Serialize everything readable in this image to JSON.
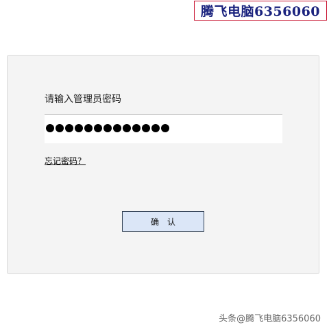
{
  "watermark": {
    "brand": "腾飞电脑6356060",
    "footer": "头条@腾飞电脑6356060"
  },
  "login": {
    "prompt": "请输入管理员密码",
    "password_length": 13,
    "forgot_link": "忘记密码？",
    "confirm_label": "确认"
  },
  "colors": {
    "brand_text": "#1a237e",
    "brand_border": "#c8102e",
    "button_bg": "#dbe6f7",
    "button_border": "#2f3e52",
    "panel_bg": "#f4f4f4"
  }
}
